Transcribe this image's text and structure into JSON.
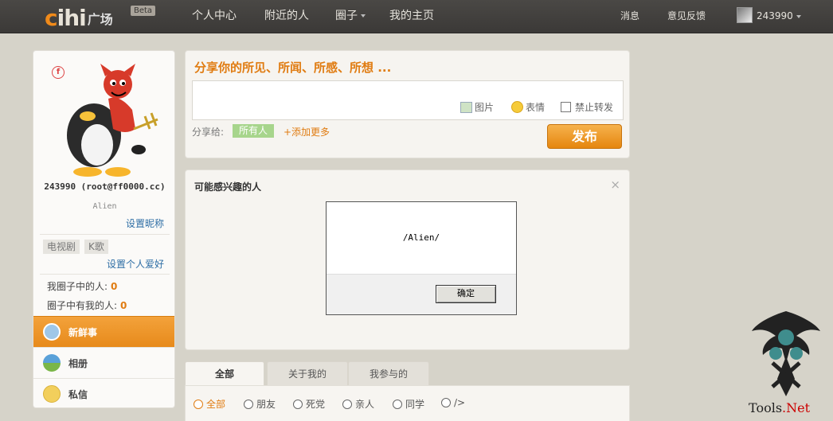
{
  "header": {
    "logo_mark": "cihi",
    "logo_sub": "广场",
    "beta": "Beta",
    "nav": [
      "个人中心",
      "附近的人",
      "圈子",
      "我的主页"
    ],
    "right": [
      "消息",
      "意见反馈"
    ],
    "user": "243990"
  },
  "sidebar": {
    "username": "243990 (root@ff0000.cc)",
    "nickname": "Alien",
    "set_nickname": "设置昵称",
    "tags": [
      "电视剧",
      "K歌"
    ],
    "set_hobby": "设置个人爱好",
    "stats": [
      {
        "label": "我圈子中的人:",
        "value": "0"
      },
      {
        "label": "圈子中有我的人:",
        "value": "0"
      }
    ],
    "menu": [
      "新鲜事",
      "相册",
      "私信"
    ]
  },
  "post": {
    "title": "分享你的所见、所闻、所感、所想 ...",
    "tools": [
      "图片",
      "表情",
      "禁止转发"
    ],
    "share_label": "分享给:",
    "share_value": "所有人",
    "share_more": "+添加更多",
    "publish": "发布"
  },
  "people": {
    "title": "可能感兴趣的人",
    "close": "×"
  },
  "tabs": [
    "全部",
    "关于我的",
    "我参与的"
  ],
  "filters": [
    "全部",
    "朋友",
    "死党",
    "亲人",
    "同学",
    "/>"
  ],
  "dialog": {
    "message": "/Alien/",
    "ok": "确定"
  },
  "watermark": {
    "text_black": "T",
    "text_mid": "ools",
    "text_red": ".Net"
  }
}
